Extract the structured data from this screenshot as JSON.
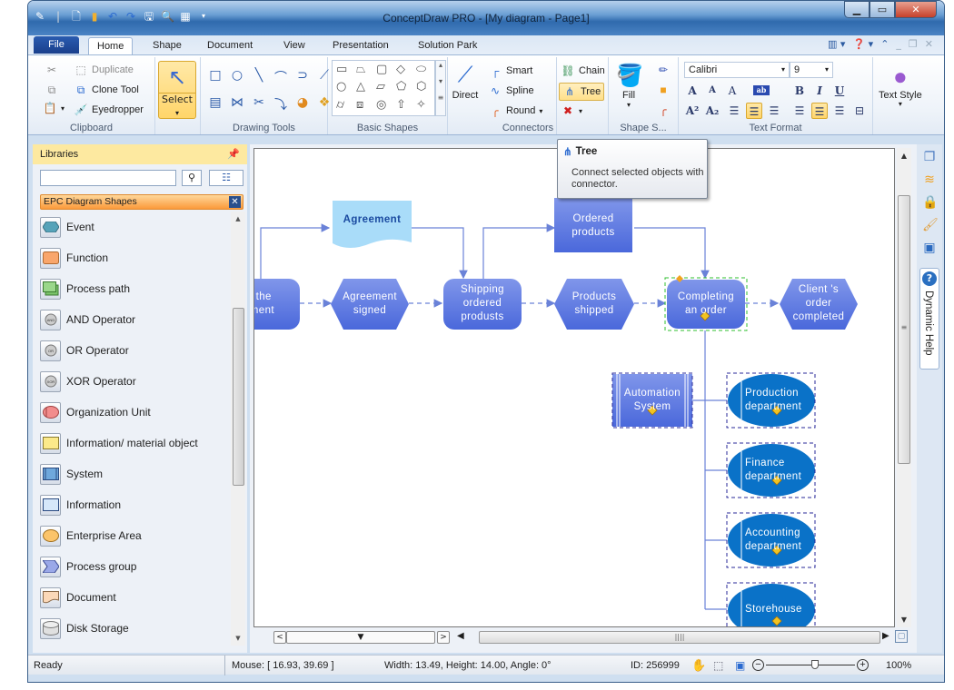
{
  "window": {
    "title": "ConceptDraw PRO - [My diagram - Page1]",
    "controls": {
      "minimize": "minimize",
      "maximize": "maximize",
      "close": "close"
    }
  },
  "quick_access": [
    "pen-icon",
    "new-document-icon",
    "open-icon",
    "undo-icon",
    "redo-icon",
    "save-icon",
    "print-preview-icon",
    "table-icon",
    "customize-dropdown-icon"
  ],
  "ribbon_tabs": [
    {
      "label": "File"
    },
    {
      "label": "Home",
      "active": true
    },
    {
      "label": "Shape"
    },
    {
      "label": "Document"
    },
    {
      "label": "View"
    },
    {
      "label": "Presentation"
    },
    {
      "label": "Solution Park"
    }
  ],
  "ribbon": {
    "clipboard": {
      "label": "Clipboard",
      "duplicate": "Duplicate",
      "clone_tool": "Clone Tool",
      "eyedropper": "Eyedropper"
    },
    "select": {
      "label": "Select"
    },
    "drawing_tools": {
      "label": "Drawing Tools"
    },
    "basic_shapes": {
      "label": "Basic Shapes"
    },
    "connectors": {
      "label": "Connectors",
      "direct": "Direct",
      "smart": "Smart",
      "spline": "Spline",
      "round": "Round",
      "chain": "Chain",
      "tree": "Tree"
    },
    "shape_style": {
      "label": "Shape S...",
      "fill": "Fill"
    },
    "text_format": {
      "label": "Text Format",
      "font": "Calibri",
      "size": "9"
    },
    "text_style": {
      "label": "Text Style"
    }
  },
  "tooltip": {
    "title": "Tree",
    "description": "Connect selected objects with connector."
  },
  "libraries": {
    "title": "Libraries",
    "search_value": "",
    "library_name": "EPC Diagram Shapes",
    "items": [
      {
        "label": "Event",
        "icon": "event-hexagon-icon"
      },
      {
        "label": "Function",
        "icon": "function-rect-icon"
      },
      {
        "label": "Process path",
        "icon": "process-path-icon"
      },
      {
        "label": "AND Operator",
        "icon": "and-operator-icon"
      },
      {
        "label": "OR Operator",
        "icon": "or-operator-icon"
      },
      {
        "label": "XOR Operator",
        "icon": "xor-operator-icon"
      },
      {
        "label": "Organization Unit",
        "icon": "organization-unit-icon"
      },
      {
        "label": "Information/ material object",
        "icon": "information-material-icon"
      },
      {
        "label": "System",
        "icon": "system-icon"
      },
      {
        "label": "Information",
        "icon": "information-icon"
      },
      {
        "label": "Enterprise Area",
        "icon": "enterprise-area-icon"
      },
      {
        "label": "Process group",
        "icon": "process-group-icon"
      },
      {
        "label": "Document",
        "icon": "document-icon"
      },
      {
        "label": "Disk Storage",
        "icon": "disk-storage-icon"
      }
    ]
  },
  "diagram": {
    "shapes": {
      "sign_agreement": "n the\nement",
      "agreement_doc": "Agreement",
      "agreement_signed": "Agreement\nsigned",
      "shipping": "Shipping\nordered\nprodusts",
      "ordered_products": "Ordered\nproducts",
      "products_shipped": "Products\nshipped",
      "completing": "Completing\nan order",
      "client_order": "Client 's\norder\ncompleted",
      "automation": "Automation\nSystem",
      "production": "Production\ndepartment",
      "finance": "Finance\ndepartment",
      "accounting": "Accounting\ndepartment",
      "storehouse": "Storehouse"
    },
    "colors": {
      "function_fill": "#5f7de0",
      "event_fill": "#5f7de0",
      "document_fill": "#a9dcf9",
      "org_unit_fill": "#0a72c8",
      "connector": "#6a82d8",
      "selection": "#2fbf2f"
    }
  },
  "right_panel": {
    "dynamic_help": "Dynamic Help"
  },
  "status_bar": {
    "state": "Ready",
    "mouse": "Mouse: [ 16.93, 39.69 ]",
    "dims": "Width: 13.49,  Height: 14.00,  Angle: 0°",
    "id": "ID: 256999",
    "zoom": "100%",
    "zoom_level": 1.0
  }
}
